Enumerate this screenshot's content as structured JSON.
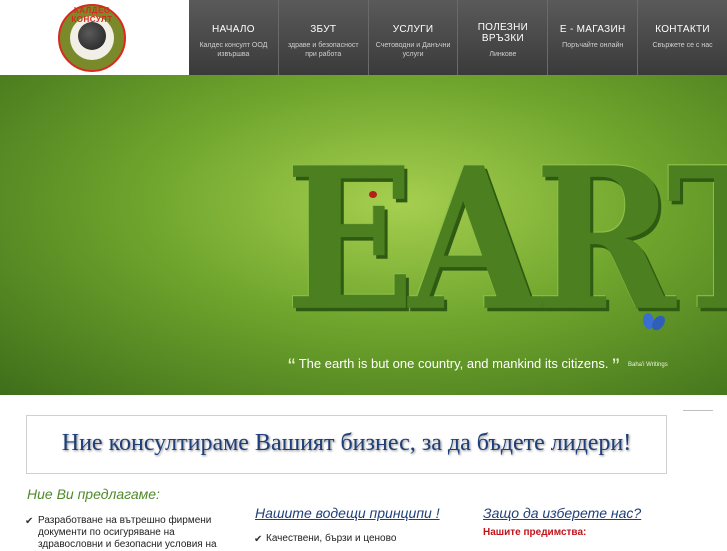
{
  "logo": {
    "text": "КАЛДЕС КОНСУЛТ"
  },
  "nav": [
    {
      "title": "НАЧАЛО",
      "sub": "Калдес консулт ООД извършва"
    },
    {
      "title": "ЗБУТ",
      "sub": "здраве и безопасност при работа"
    },
    {
      "title": "УСЛУГИ",
      "sub": "Счетоводни и Данъчни услуги"
    },
    {
      "title": "ПОЛЕЗНИ ВРЪЗКИ",
      "sub": "Линкове"
    },
    {
      "title": "Е - МАГАЗИН",
      "sub": "Поръчайте онлайн"
    },
    {
      "title": "КОНТАКТИ",
      "sub": "Свържете се с нас"
    }
  ],
  "hero": {
    "word": "EARTH",
    "quote": "The earth is but one country, and mankind its citizens.",
    "source": "Baha'i Writings"
  },
  "tagline": "Ние консултираме Вашият бизнес, за да бъдете лидери!",
  "offer": {
    "title": "Ние Ви предлагаме:",
    "items": [
      "Разработване на вътрешно фирмени документи по осигуряване на здравословни и безопасни условия на"
    ]
  },
  "principles": {
    "title": "Нашите водещи принципи !",
    "items": [
      "Качествени, бързи и ценово"
    ]
  },
  "why": {
    "title": "Защо да изберете нас?",
    "advantages_label": "Нашите предимства:"
  },
  "colors": {
    "nav_bg": "#4a4a4a",
    "accent_green": "#4f8a2a",
    "link_blue": "#1f3f7a",
    "alert_red": "#c0141a"
  }
}
